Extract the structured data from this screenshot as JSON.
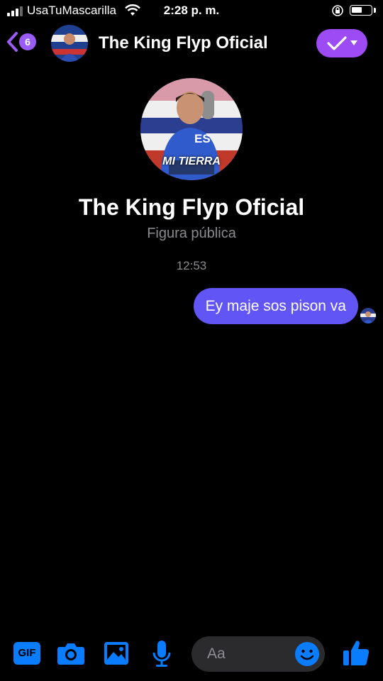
{
  "status_bar": {
    "carrier": "UsaTuMascarilla",
    "time": "2:28 p. m."
  },
  "header": {
    "back_badge_count": "6",
    "title": "The King Flyp Oficial",
    "avatar_icon": "profile-photo",
    "action_icon": "checkmark-dropdown-icon",
    "accent_color": "#9d4cf5"
  },
  "profile": {
    "name": "The King Flyp Oficial",
    "subtitle": "Figura pública",
    "avatar_caption": "MI TIERRA",
    "shirt_text": "ES"
  },
  "conversation": {
    "timestamp": "12:53",
    "messages": [
      {
        "sender": "me",
        "text": "Ey maje sos pison va",
        "bubble_color": "#6255f5"
      }
    ]
  },
  "composer": {
    "placeholder": "Aa",
    "gif_label": "GIF",
    "icons": [
      "gif-icon",
      "camera-icon",
      "image-icon",
      "microphone-icon",
      "emoji-icon",
      "like-icon"
    ],
    "icon_color": "#0a7cff"
  }
}
